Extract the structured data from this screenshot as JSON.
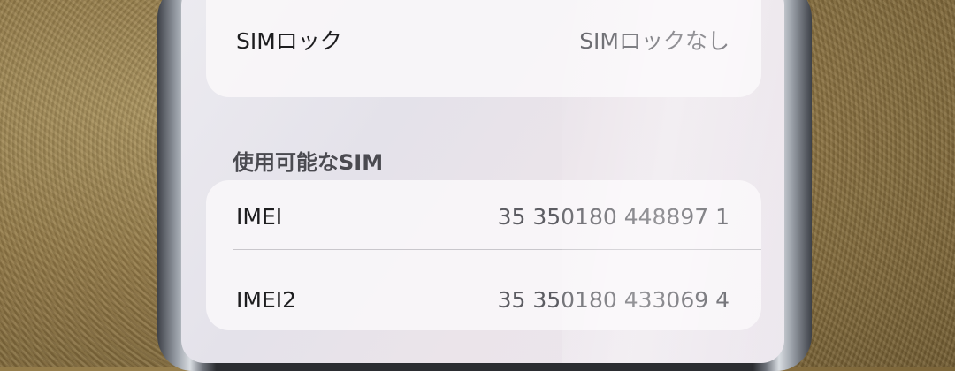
{
  "sim_lock": {
    "label": "SIMロック",
    "value": "SIMロックなし"
  },
  "available_sim": {
    "header": "使用可能なSIM",
    "rows": [
      {
        "label": "IMEI",
        "value": "35 350180 448897 1"
      },
      {
        "label": "IMEI2",
        "value": "35 350180 433069 4"
      }
    ]
  }
}
